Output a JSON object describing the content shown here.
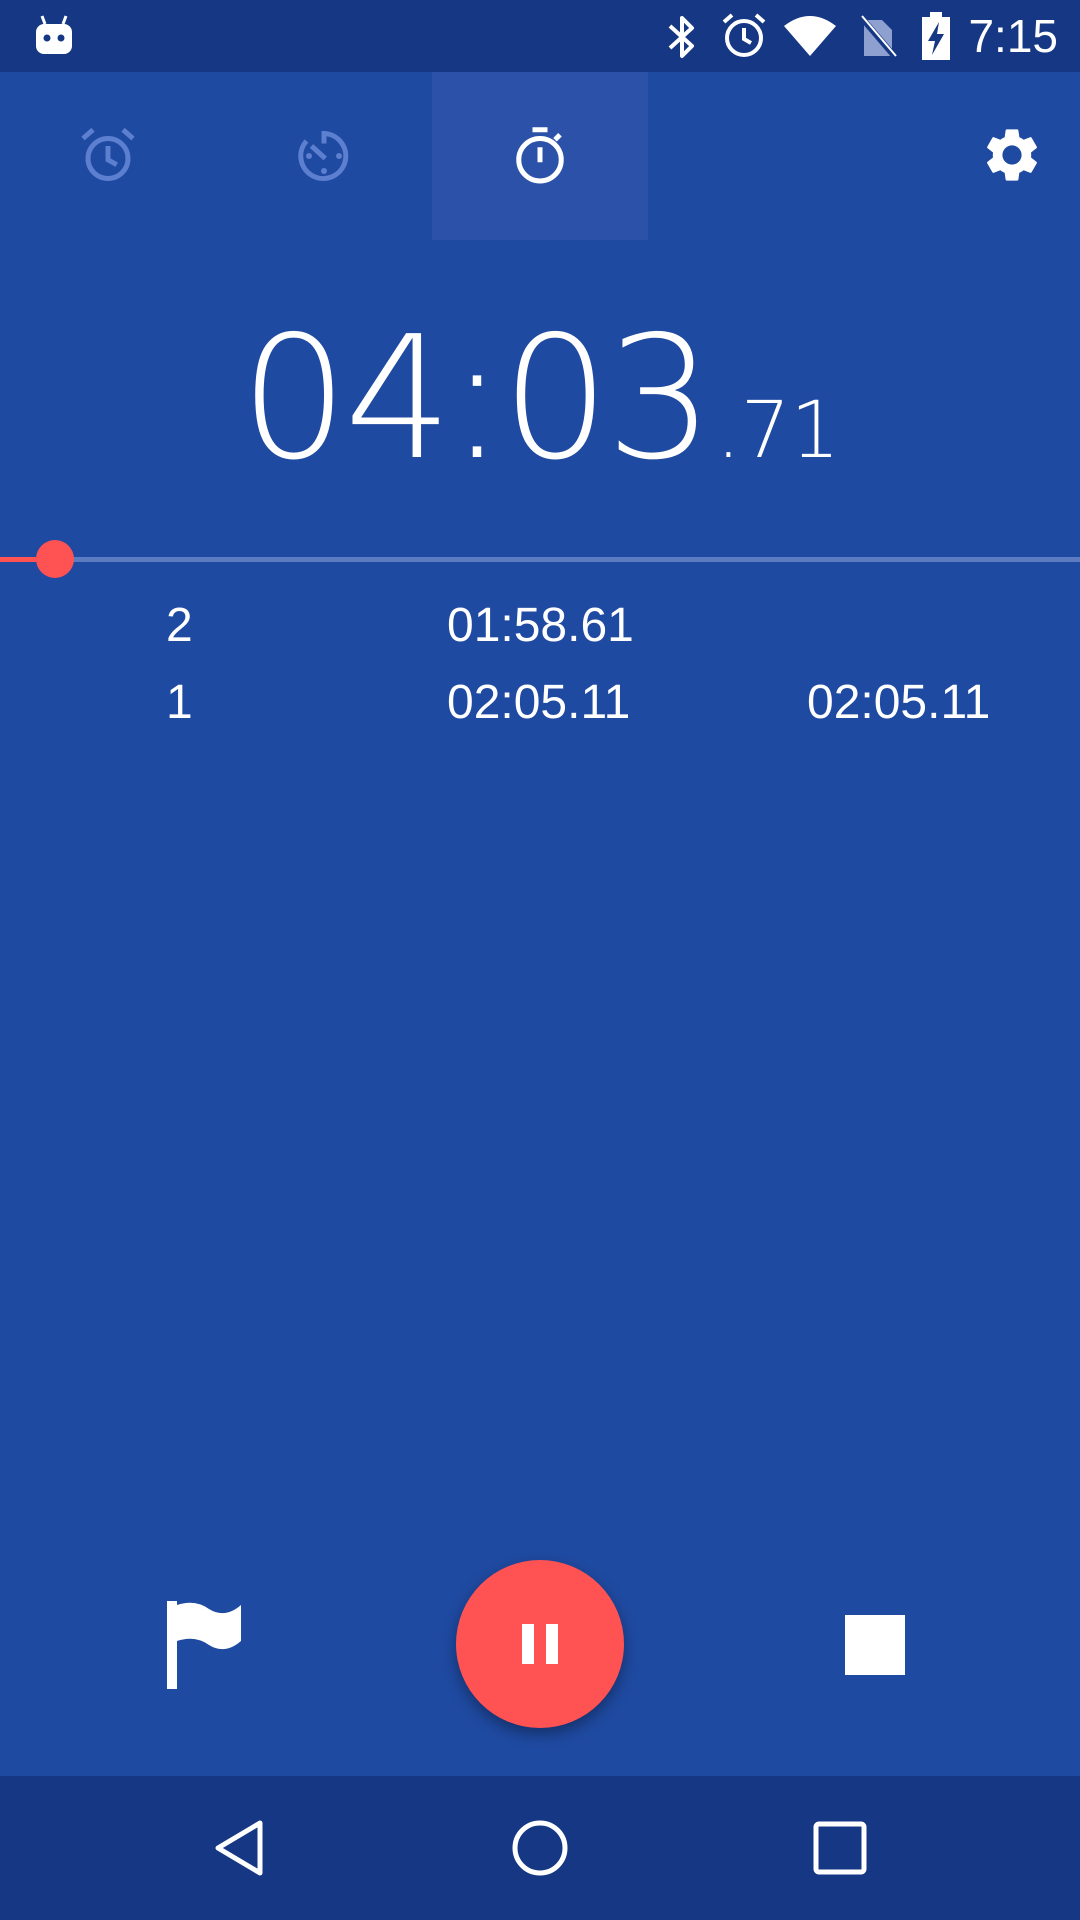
{
  "status_bar": {
    "time": "7:15",
    "icons": [
      "android-notification-icon",
      "bluetooth-icon",
      "alarm-icon",
      "wifi-icon",
      "no-sim-icon",
      "battery-charging-icon"
    ]
  },
  "tabs": [
    {
      "name": "alarm",
      "icon": "alarm-clock-icon",
      "selected": false
    },
    {
      "name": "timer",
      "icon": "timer-icon",
      "selected": false
    },
    {
      "name": "stopwatch",
      "icon": "stopwatch-icon",
      "selected": true
    }
  ],
  "settings_icon": "gear-icon",
  "stopwatch": {
    "main": "04:03",
    "fraction": ".71",
    "progress_fraction": 0.051
  },
  "laps": [
    {
      "number": "2",
      "lap_time": "01:58.61",
      "total_time": ""
    },
    {
      "number": "1",
      "lap_time": "02:05.11",
      "total_time": "02:05.11"
    }
  ],
  "controls": {
    "lap_icon": "flag-icon",
    "pause_icon": "pause-icon",
    "stop_icon": "stop-icon"
  },
  "navigation": [
    "back-icon",
    "home-icon",
    "recents-icon"
  ],
  "colors": {
    "background": "#1f4aa1",
    "status_bar": "#163784",
    "accent": "#ff5252",
    "selected_tab": "#2b52a8"
  }
}
